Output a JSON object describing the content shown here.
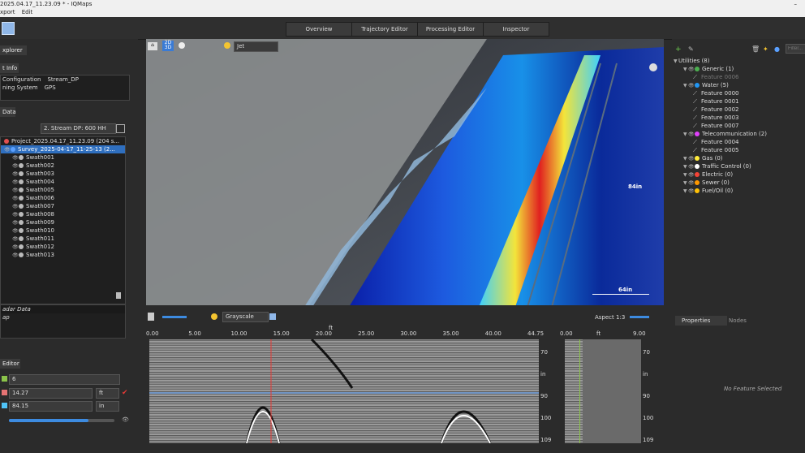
{
  "window": {
    "title": "2025.04.17_11.23.09 * - IQMaps"
  },
  "menu": [
    "xport",
    "Edit"
  ],
  "top_tabs": [
    "Overview",
    "Trajectory Editor",
    "Processing Editor",
    "Inspector"
  ],
  "explorer": {
    "tab": "xplorer",
    "info_header": "t Info",
    "info_rows": [
      {
        "label": "Configuration",
        "value": "Stream_DP"
      },
      {
        "label": "ning System",
        "value": "GPS"
      }
    ],
    "data_header": "Data",
    "stream_select": "2. Stream DP: 600 HH",
    "project": "Project_2025.04.17_11.23.09 (204 s...",
    "survey": "Survey_2025-04-17_11-25-13 (2...",
    "swaths": [
      "Swath001",
      "Swath002",
      "Swath003",
      "Swath004",
      "Swath005",
      "Swath006",
      "Swath007",
      "Swath008",
      "Swath009",
      "Swath010",
      "Swath011",
      "Swath012",
      "Swath013"
    ]
  },
  "layers": {
    "items": [
      "adar Data",
      "ap"
    ]
  },
  "editor": {
    "header": "Editor",
    "field1": "6",
    "field2": "14.27",
    "field2_unit": "ft",
    "field3": "84.15",
    "field3_unit": "in",
    "slider_fraction": 0.75
  },
  "view3d": {
    "colormap": "Jet",
    "label_2d3d": "2D 3D",
    "depth_label": "84in",
    "scale_label": "64in"
  },
  "gpr_view": {
    "colormap": "Grayscale",
    "aspect": "Aspect 1:3",
    "x_unit": "ft",
    "x_ticks": [
      "0.00",
      "5.00",
      "10.00",
      "15.00",
      "20.00",
      "25.00",
      "30.00",
      "35.00",
      "40.00",
      "44.75"
    ],
    "y_ticks": [
      "70",
      "in",
      "90",
      "100",
      "109"
    ],
    "side_x_ticks": [
      "0.00",
      "ft",
      "9.00"
    ],
    "side_y_ticks": [
      "70",
      "in",
      "90",
      "100",
      "109"
    ]
  },
  "utilities": {
    "filter_placeholder": "Filter...",
    "tree": [
      {
        "label": "Utilities (8)",
        "level": 0
      },
      {
        "label": "Generic (1)",
        "level": 1,
        "color": "#4caf50"
      },
      {
        "label": "Feature 0006",
        "level": 2,
        "dim": true
      },
      {
        "label": "Water (5)",
        "level": 1,
        "color": "#2196f3"
      },
      {
        "label": "Feature 0000",
        "level": 2
      },
      {
        "label": "Feature 0001",
        "level": 2
      },
      {
        "label": "Feature 0002",
        "level": 2
      },
      {
        "label": "Feature 0003",
        "level": 2
      },
      {
        "label": "Feature 0007",
        "level": 2
      },
      {
        "label": "Telecommunication (2)",
        "level": 1,
        "color": "#e040fb"
      },
      {
        "label": "Feature 0004",
        "level": 2
      },
      {
        "label": "Feature 0005",
        "level": 2
      },
      {
        "label": "Gas (0)",
        "level": 1,
        "color": "#ffeb3b"
      },
      {
        "label": "Traffic Control (0)",
        "level": 1,
        "color": "#ffffff"
      },
      {
        "label": "Electric (0)",
        "level": 1,
        "color": "#f44336"
      },
      {
        "label": "Sewer (0)",
        "level": 1,
        "color": "#ff9800"
      },
      {
        "label": "Fuel/Oil (0)",
        "level": 1,
        "color": "#ffc107"
      }
    ]
  },
  "props": {
    "tab1": "Properties",
    "tab2": "Nodes",
    "empty": "No Feature Selected"
  }
}
